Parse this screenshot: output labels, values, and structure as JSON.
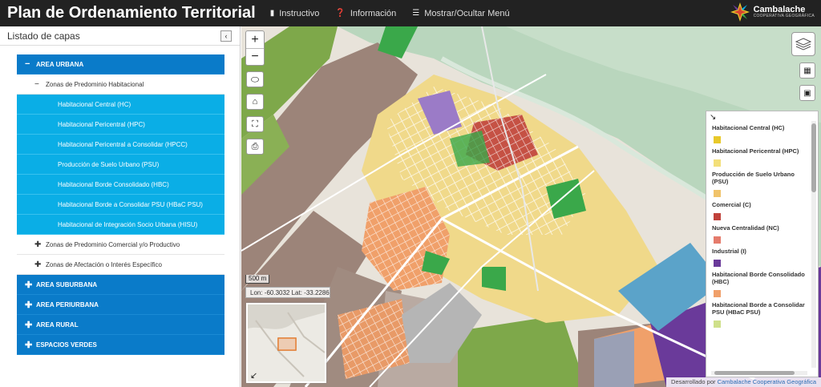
{
  "app": {
    "title": "Plan de Ordenamiento Territorial"
  },
  "nav": {
    "instructivo": "Instructivo",
    "informacion": "Información",
    "toggle_menu": "Mostrar/Ocultar Menú"
  },
  "brand": {
    "name": "Cambalache",
    "subtitle": "COOPERATIVA GEOGRÁFICA"
  },
  "sidebar": {
    "title": "Listado de capas",
    "collapse_symbol": "‹",
    "tree": {
      "area_urbana": {
        "symbol": "−",
        "label": "AREA URBANA"
      },
      "zonas_hab": {
        "symbol": "−",
        "label": "Zonas de Predominio Habitacional"
      },
      "layers": [
        "Habitacional Central (HC)",
        "Habitacional Pericentral (HPC)",
        "Habitacional Pericentral a Consolidar (HPCC)",
        "Producción de Suelo Urbano (PSU)",
        "Habitacional Borde Consolidado (HBC)",
        "Habitacional Borde a Consolidar PSU (HBaC PSU)",
        "Habitacional de Integración Socio Urbana (HISU)"
      ],
      "zonas_comercial": {
        "symbol": "✚",
        "label": "Zonas de Predominio Comercial y/o Productivo"
      },
      "zonas_afectacion": {
        "symbol": "✚",
        "label": "Zonas de Afectación o Interés Específico"
      },
      "area_suburbana": {
        "symbol": "✚",
        "label": "AREA SUBURBANA"
      },
      "area_periurbana": {
        "symbol": "✚",
        "label": "AREA PERIURBANA"
      },
      "area_rural": {
        "symbol": "✚",
        "label": "AREA RURAL"
      },
      "espacios_verdes": {
        "symbol": "✚",
        "label": "ESPACIOS VERDES"
      }
    }
  },
  "map": {
    "zoom_in": "+",
    "zoom_out": "−",
    "scale_label": "500 m",
    "coords": "Lon: -60.3032 Lat: -33.2286",
    "credits_prefix": "Desarrollado por",
    "credits_link": "Cambalache Cooperativa Geográfica"
  },
  "legend": {
    "items": [
      {
        "label": "Habitacional Central (HC)",
        "color": "#e8c92a"
      },
      {
        "label": "Habitacional Pericentral (HPC)",
        "color": "#f3df7a"
      },
      {
        "label": "Producción de Suelo Urbano (PSU)",
        "color": "#f0c36a"
      },
      {
        "label": "Comercial (C)",
        "color": "#c0413b"
      },
      {
        "label": "Nueva Centralidad (NC)",
        "color": "#e57b6c"
      },
      {
        "label": "Industrial (I)",
        "color": "#6a3a9a"
      },
      {
        "label": "Habitacional Borde Consolidado (HBC)",
        "color": "#f0a06a"
      },
      {
        "label": "Habitacional Borde a Consolidar PSU (HBaC PSU)",
        "color": "#cfe08a"
      }
    ]
  },
  "colors": {
    "topbar": "#222222",
    "category_blue": "#0a7bc9",
    "layer_blue": "#0aaee6",
    "river_green": "#bcd8c0",
    "rural_brown": "#9c8479",
    "green_zone": "#7ea84a",
    "industrial_purple": "#6a3a9a",
    "lake_blue": "#5ba3c9"
  }
}
